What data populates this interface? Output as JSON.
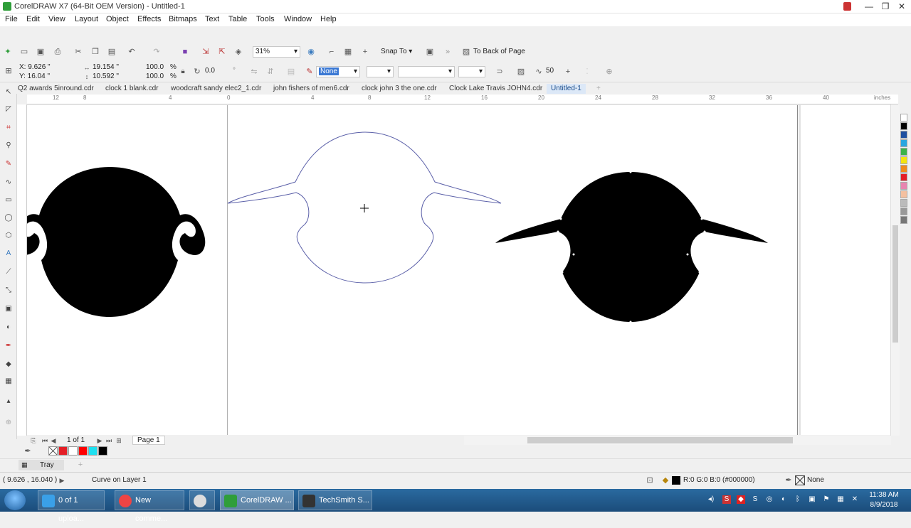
{
  "window": {
    "title": "CorelDRAW X7 (64-Bit OEM Version) - Untitled-1",
    "minimize": "—",
    "maximize": "❐",
    "close": "✕"
  },
  "menu": [
    "File",
    "Edit",
    "View",
    "Layout",
    "Object",
    "Effects",
    "Bitmaps",
    "Text",
    "Table",
    "Tools",
    "Window",
    "Help"
  ],
  "toolbar": {
    "zoom": "31%",
    "snap_to": "Snap To",
    "to_back": "To Back of Page"
  },
  "properties": {
    "x": "X: 9.626 \"",
    "y": "Y: 16.04 \"",
    "width": "19.154 \"",
    "height": "10.592 \"",
    "scale_x": "100.0",
    "scale_y": "100.0",
    "percent": "%",
    "rotation": "0.0",
    "degree": "°",
    "outline": "None",
    "smoothing": "50"
  },
  "doc_tabs": [
    "Q2 awards 5inround.cdr",
    "clock 1 blank.cdr",
    "woodcraft sandy elec2_1.cdr",
    "john fishers of men6.cdr",
    "clock john 3 the one.cdr",
    "Clock Lake Travis JOHN4.cdr",
    "Untitled-1"
  ],
  "ruler": {
    "labels": [
      "12",
      "8",
      "4",
      "0",
      "4",
      "8",
      "12",
      "16",
      "20",
      "24",
      "28",
      "32",
      "36",
      "40"
    ],
    "units": "inches"
  },
  "page_nav": {
    "page_count": "1 of 1",
    "page_tab": "Page 1"
  },
  "tray": {
    "label": "Tray"
  },
  "status": {
    "coords": "( 9.626 , 16.040 )",
    "object": "Curve on Layer 1",
    "fill": "R:0 G:0 B:0 (#000000)",
    "outline": "None"
  },
  "taskbar": {
    "items": [
      "0 of 1 uploa...",
      "New comme...",
      "",
      "CorelDRAW ...",
      "TechSmith S..."
    ],
    "time": "11:38 AM",
    "date": "8/9/2018"
  },
  "colors": {
    "accent": "#2f9e3a",
    "shape_fill": "#000000",
    "outline_curve": "#5a5fa8"
  }
}
